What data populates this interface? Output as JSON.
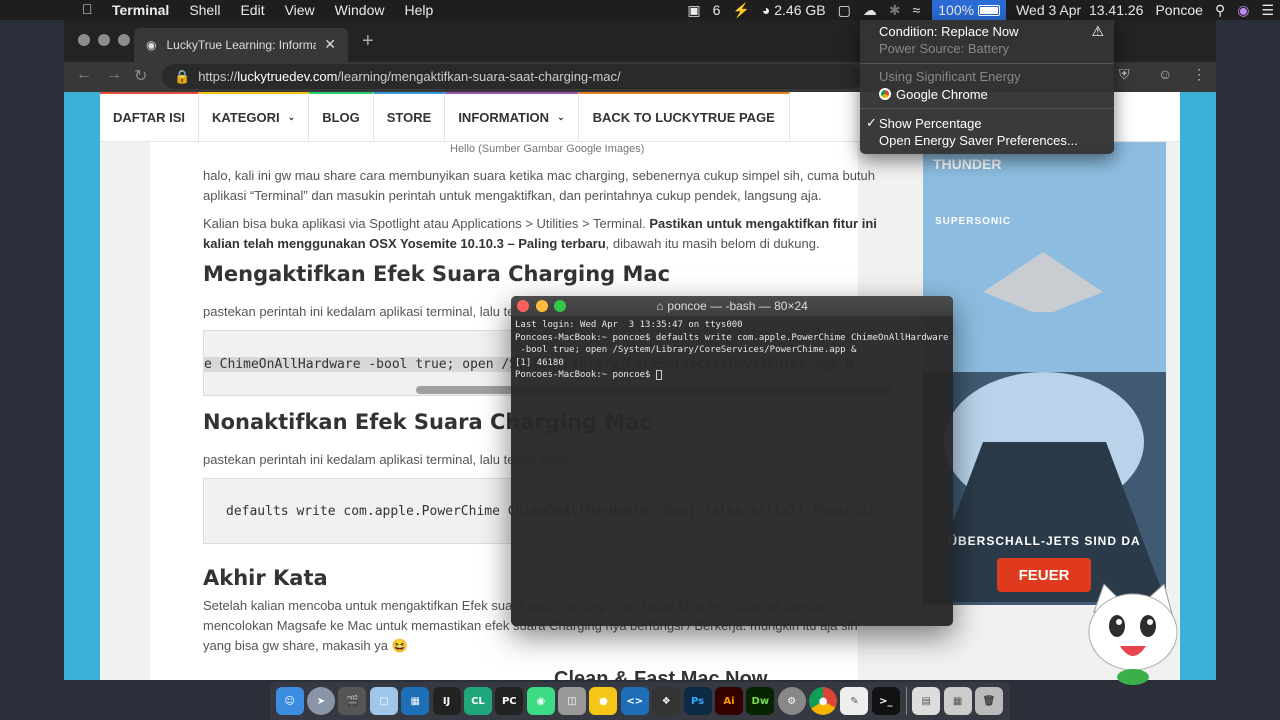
{
  "menubar": {
    "app_name": "Terminal",
    "menus": [
      "Shell",
      "Edit",
      "View",
      "Window",
      "Help"
    ],
    "status_six": "6",
    "memory": "2.46 GB",
    "battery_percent": "100%",
    "datetime": "Wed 3 Apr  13.41.26",
    "user": "Poncoe"
  },
  "browser": {
    "tab_title": "LuckyTrue Learning: Informasi",
    "url_scheme": "https://",
    "url_host": "luckytruedev.com",
    "url_path": "/learning/mengaktifkan-suara-saat-charging-mac/"
  },
  "site_nav": {
    "items": [
      "DAFTAR ISI",
      "KATEGORI",
      "BLOG",
      "STORE",
      "INFORMATION",
      "BACK TO LUCKYTRUE PAGE"
    ]
  },
  "article": {
    "caption": "Hello (Sumber Gambar Google Images)",
    "p1": "halo, kali ini gw mau share cara membunyikan suara ketika mac charging, sebenernya cukup simpel sih, cuma butuh aplikasi “Terminal” dan masukin perintah untuk mengaktifkan, dan perintahnya cukup pendek, langsung aja.",
    "p2_normal": "Kalian bisa buka aplikasi via Spotlight atau Applications > Utilities > Terminal.",
    "p2_bold": "Pastikan untuk mengaktifkan fitur ini kalian telah menggunakan OSX Yosemite 10.10.3 – Paling terbaru",
    "p2_tail": ", dibawah itu masih belom di dukung.",
    "h_enable": "Mengaktifkan Efek Suara Charging Mac",
    "p3": "pastekan perintah ini kedalam aplikasi terminal, lalu teka",
    "code1": "e ChimeOnAllHardware -bool true; open /System/Library/CoreServices/PowerChime.app &",
    "h_disable": "Nonaktifkan Efek Suara Charging Mac",
    "p4": "pastekan perintah ini kedalam aplikasi terminal, lalu tekan enter",
    "code2": "defaults write com.apple.PowerChime ChimeOnAllHardware -bool false;killall PowerChi",
    "h_end": "Akhir Kata",
    "p5": "Setelah kalian mencoba untuk mengaktifkan Efek suara saat charging mac, kalian bisa mencobanya dengan mencolokan Magsafe ke Mac untuk memastikan efek suara Charging nya berfungsi / Berkerja. mungkin itu aja sih yang bisa gw share, makasih ya 😆",
    "bottom_ad": "Clean & Fast Mac Now"
  },
  "ad": {
    "title": "THUNDER",
    "subtitle": "SUPERSONIC",
    "tagline": "ÜBERSCHALL-JETS SIND DA",
    "button": "FEUER"
  },
  "terminal": {
    "title": "poncoe — -bash — 80×24",
    "lines": [
      "Last login: Wed Apr  3 13:35:47 on ttys000",
      "Poncoes-MacBook:~ poncoe$ defaults write com.apple.PowerChime ChimeOnAllHardware",
      " -bool true; open /System/Library/CoreServices/PowerChime.app &",
      "[1] 46180",
      "Poncoes-MacBook:~ poncoe$ "
    ]
  },
  "battery_menu": {
    "condition": "Condition: Replace Now",
    "power_source": "Power Source: Battery",
    "using_energy": "Using Significant Energy",
    "app": "Google Chrome",
    "show_percentage": "Show Percentage",
    "open_prefs": "Open Energy Saver Preferences..."
  },
  "dock": {
    "labels": [
      "IJ",
      "CL",
      "PC",
      "Ps",
      "Ai",
      "Dw"
    ]
  },
  "colors": {
    "menubar": "#1e1e1e",
    "battery_highlight": "#2a6bd4",
    "page_bg": "#3bb0d8",
    "ad_button": "#e03a1e"
  }
}
